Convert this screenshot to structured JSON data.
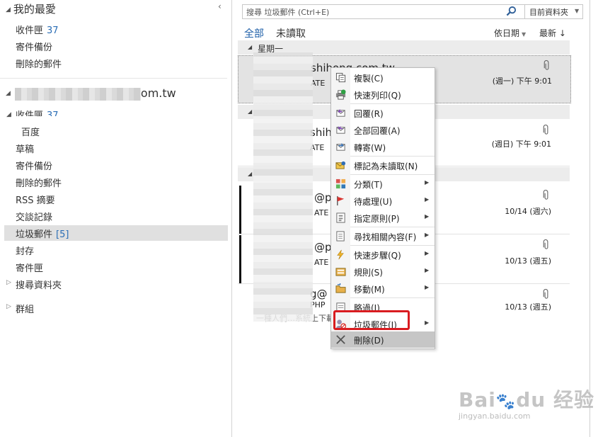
{
  "favorites": {
    "header": "我的最愛",
    "items": [
      {
        "label": "收件匣",
        "count": "37"
      },
      {
        "label": "寄件備份",
        "count": ""
      },
      {
        "label": "刪除的郵件",
        "count": ""
      }
    ]
  },
  "account": {
    "name_suffix": "om.tw",
    "folders": [
      {
        "label": "收件匣",
        "count": "37"
      },
      {
        "label": "百度",
        "count": ""
      },
      {
        "label": "草稿",
        "count": ""
      },
      {
        "label": "寄件備份",
        "count": ""
      },
      {
        "label": "刪除的郵件",
        "count": ""
      },
      {
        "label": "RSS 摘要",
        "count": ""
      },
      {
        "label": "交談記錄",
        "count": ""
      },
      {
        "label": "垃圾郵件",
        "count": "[5]"
      },
      {
        "label": "封存",
        "count": ""
      },
      {
        "label": "寄件匣",
        "count": ""
      },
      {
        "label": "搜尋資料夾",
        "count": ""
      }
    ],
    "groups_label": "群組"
  },
  "search": {
    "placeholder": "搜尋 垃圾郵件 (Ctrl+E)",
    "scope": "目前資料夾"
  },
  "filters": {
    "all": "全部",
    "unread": "未讀取",
    "sort_by": "依日期",
    "order": "最新"
  },
  "groups": [
    {
      "label": "星期一"
    }
  ],
  "messages": [
    {
      "sender": "shihong.com.tw",
      "subject": "ATE",
      "date": "(週一) 下午 9:01"
    },
    {
      "sender": "shih",
      "subject": "ATE",
      "date": "(週日) 下午 9:01"
    },
    {
      "sender": "@p",
      "subject": "ATE",
      "date": "10/14 (週六)"
    },
    {
      "sender": "@p",
      "subject": "ATE",
      "date": "10/13 (週五)"
    },
    {
      "sender": "g@",
      "subject": "PHP",
      "date": "10/13 (週五)",
      "preview": "一種人們…系統上下載…下檔案…的數據"
    }
  ],
  "context_menu": {
    "items": [
      {
        "label": "複製(C)",
        "icon": "copy-icon"
      },
      {
        "label": "快速列印(Q)",
        "icon": "print-icon"
      },
      {
        "label": "回覆(R)",
        "icon": "reply-icon"
      },
      {
        "label": "全部回覆(A)",
        "icon": "reply-all-icon"
      },
      {
        "label": "轉寄(W)",
        "icon": "forward-icon"
      },
      {
        "label": "標記為未讀取(N)",
        "icon": "mark-unread-icon"
      },
      {
        "label": "分類(T)",
        "icon": "categorize-icon"
      },
      {
        "label": "待處理(U)",
        "icon": "flag-icon"
      },
      {
        "label": "指定原則(P)",
        "icon": "policy-icon"
      },
      {
        "label": "尋找相關內容(F)",
        "icon": "find-related-icon"
      },
      {
        "label": "快速步驟(Q)",
        "icon": "quick-steps-icon"
      },
      {
        "label": "規則(S)",
        "icon": "rules-icon"
      },
      {
        "label": "移動(M)",
        "icon": "move-icon"
      },
      {
        "label": "略過(I)",
        "icon": "ignore-icon"
      },
      {
        "label": "垃圾郵件(J)",
        "icon": "junk-icon"
      },
      {
        "label": "刪除(D)",
        "icon": "delete-icon"
      }
    ]
  },
  "watermark": {
    "logo": "Bai du 经验",
    "url": "jingyan.baidu.com"
  },
  "colors": {
    "accent": "#1e5fa8",
    "highlight": "#d91c20"
  }
}
